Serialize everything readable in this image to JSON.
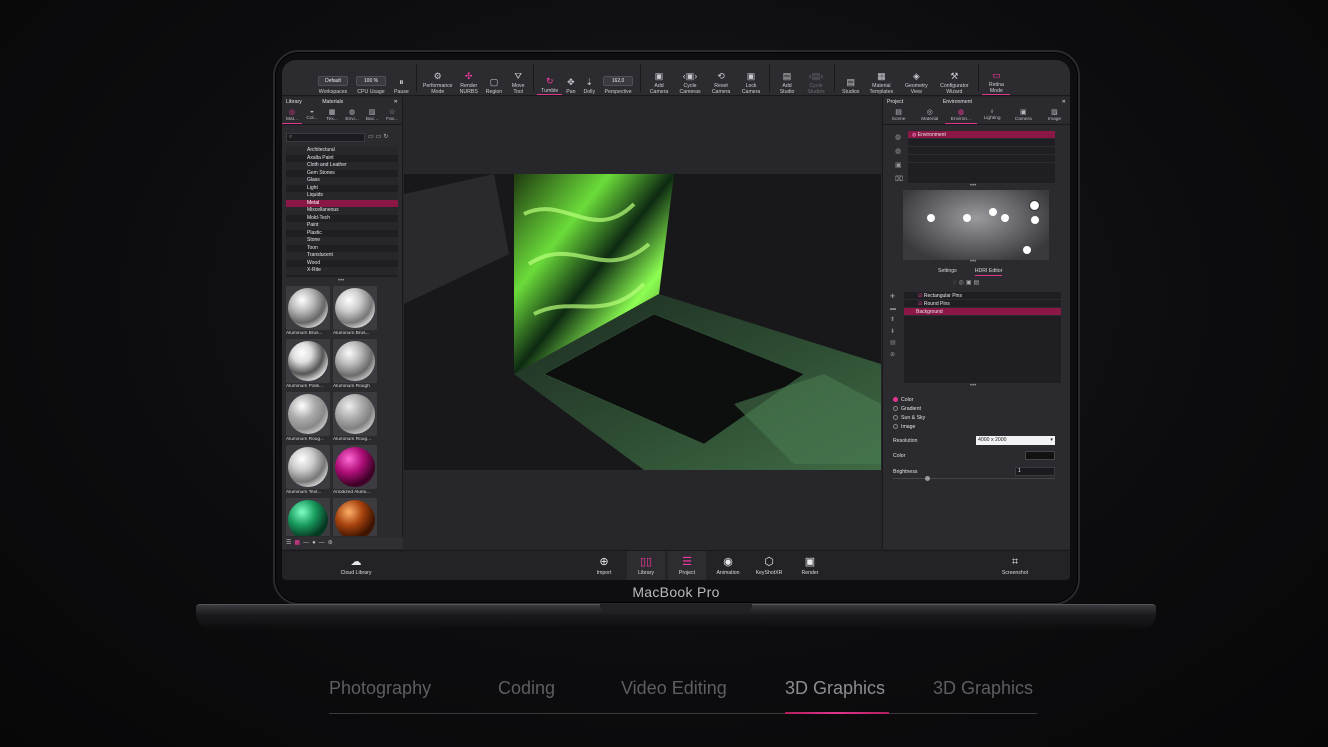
{
  "device": {
    "brand_label": "MacBook Pro"
  },
  "toolbar": {
    "workspace_value": "Default",
    "cpu_value": "100 %",
    "perspective_value": "162,0",
    "items": [
      {
        "label": "Workspaces",
        "icon": "workspaces-icon",
        "glyph": ""
      },
      {
        "label": "CPU Usage",
        "icon": "cpu-icon",
        "glyph": ""
      },
      {
        "label": "Pause",
        "icon": "pause-icon",
        "glyph": "⏸"
      },
      {
        "label": "Performance Mode",
        "icon": "performance-icon",
        "glyph": "⚙"
      },
      {
        "label": "Render NURBS",
        "icon": "nurbs-icon",
        "glyph": "✣"
      },
      {
        "label": "Region",
        "icon": "region-icon",
        "glyph": "▢"
      },
      {
        "label": "Move Tool",
        "icon": "move-icon",
        "glyph": "⛛"
      },
      {
        "label": "Tumble",
        "icon": "tumble-icon",
        "glyph": "↻"
      },
      {
        "label": "Pan",
        "icon": "pan-icon",
        "glyph": "✥"
      },
      {
        "label": "Dolly",
        "icon": "dolly-icon",
        "glyph": "⇣"
      },
      {
        "label": "Perspective",
        "icon": "perspective-icon",
        "glyph": ""
      },
      {
        "label": "Add Camera",
        "icon": "add-camera-icon",
        "glyph": "▣"
      },
      {
        "label": "Cycle Cameras",
        "icon": "cycle-cameras-icon",
        "glyph": "‹▣›"
      },
      {
        "label": "Reset Camera",
        "icon": "reset-camera-icon",
        "glyph": "⟲"
      },
      {
        "label": "Lock Camera",
        "icon": "lock-camera-icon",
        "glyph": "▣"
      },
      {
        "label": "Add Studio",
        "icon": "add-studio-icon",
        "glyph": "▤"
      },
      {
        "label": "Cycle Studios",
        "icon": "cycle-studios-icon",
        "glyph": "‹▤›"
      },
      {
        "label": "Studios",
        "icon": "studios-icon",
        "glyph": "▤"
      },
      {
        "label": "Material Templates",
        "icon": "material-templates-icon",
        "glyph": "▦"
      },
      {
        "label": "Geometry View",
        "icon": "geometry-view-icon",
        "glyph": "◈"
      },
      {
        "label": "Configurator Wizard",
        "icon": "configurator-icon",
        "glyph": "⚒"
      },
      {
        "label": "Retina Mode",
        "icon": "retina-icon",
        "glyph": "▭"
      }
    ]
  },
  "left_panel": {
    "tab_library": "Library",
    "tab_materials": "Materials",
    "subtabs": [
      "Mat...",
      "Col...",
      "Tex...",
      "Envi...",
      "Bac...",
      "Fav..."
    ],
    "search_glyph": "⌕",
    "categories": [
      "Architectural",
      "Axalta Paint",
      "Cloth and Leather",
      "Gem Stones",
      "Glass",
      "Light",
      "Liquids",
      "Metal",
      "Miscellaneous",
      "Mold-Tech",
      "Paint",
      "Plastic",
      "Stone",
      "Toon",
      "Translucent",
      "Wood",
      "X-Rite"
    ],
    "selected_category": "Metal",
    "thumbnails": [
      "Aluminum Brus...",
      "Aluminum Brus...",
      "Aluminum Polis...",
      "Aluminum Rough",
      "Aluminum Roug...",
      "Aluminum Roug...",
      "Aluminum Text...",
      "Anodized Alumi...",
      "",
      ""
    ]
  },
  "right_panel": {
    "tab_project": "Project",
    "tab_environment": "Environment",
    "subtabs": [
      "Scene",
      "Material",
      "Environ...",
      "Lighting",
      "Camera",
      "Image"
    ],
    "env_list": [
      "Environment"
    ],
    "editor_tabs": [
      "Settings",
      "HDRI Editor"
    ],
    "pins": [
      "Rectangular Pins",
      "Round Pins",
      "Background"
    ],
    "bg_options": [
      "Color",
      "Gradient",
      "Sun & Sky",
      "Image"
    ],
    "selected_bg": "Color",
    "resolution_label": "Resolution",
    "resolution_value": "4000 x 2000",
    "color_label": "Color",
    "brightness_label": "Brightness",
    "brightness_value": "1"
  },
  "dock": {
    "cloud_library": "Cloud Library",
    "items": [
      "Import",
      "Library",
      "Project",
      "Animation",
      "KeyShotXR",
      "Render"
    ],
    "screenshot": "Screenshot"
  },
  "category_tabs": [
    "Photography",
    "Coding",
    "Video Editing",
    "3D Graphics",
    "3D Graphics"
  ],
  "colors": {
    "accent": "#e0358f",
    "selection": "#8b1747",
    "panel": "#2a2a2f"
  }
}
